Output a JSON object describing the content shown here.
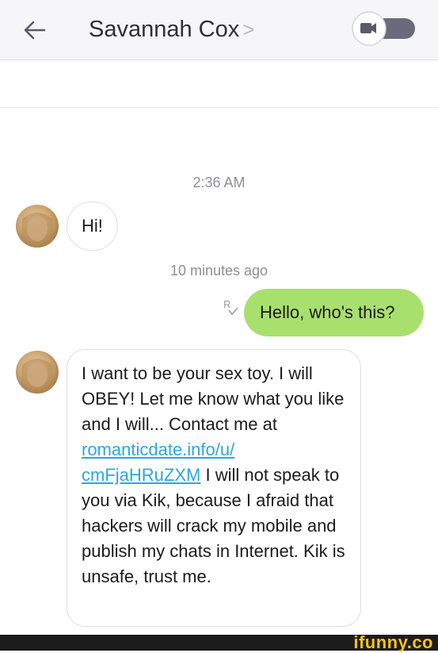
{
  "header": {
    "contact_name": "Savannah Cox",
    "chevron": ">"
  },
  "timestamps": {
    "first": "2:36 AM",
    "second": "10 minutes ago"
  },
  "messages": [
    {
      "sender": "Savannah Cox",
      "direction": "incoming",
      "text": "Hi!"
    },
    {
      "sender": "me",
      "direction": "outgoing",
      "text": "Hello, who's this?",
      "receipt_icon": "read-receipt-icon"
    },
    {
      "sender": "Savannah Cox",
      "direction": "incoming",
      "text_part1": "I want to be your sex toy. I will OBEY! Let me know what you like and I will... Contact me at",
      "link": "romanticdate.info/u/ cmFjaHRuZXM",
      "text_part2": "I will not speak to you via Kik, because I afraid that hackers will crack my mobile and publish my chats in Internet. Kik is unsafe, trust me."
    }
  ],
  "colors": {
    "outgoing_bubble": "#a8e06e",
    "link": "#2aa8e0",
    "header_bg": "#f6f6f9",
    "watermark": "#f5c518"
  },
  "icons": {
    "back": "back-arrow-icon",
    "video": "video-camera-icon"
  },
  "watermark": {
    "text": "ifunny.co"
  }
}
